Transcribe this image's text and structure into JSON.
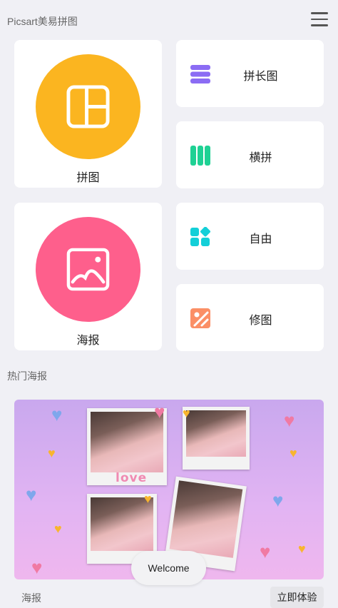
{
  "header": {
    "title": "Picsart美易拼图",
    "menu_icon": "menu-icon"
  },
  "tiles": {
    "collage": {
      "label": "拼图",
      "color": "#fbb520",
      "icon": "collage-grid-icon"
    },
    "poster": {
      "label": "海报",
      "color": "#fe5f8c",
      "icon": "image-icon"
    },
    "long": {
      "label": "拼长图",
      "color": "#8b6cf4",
      "icon": "stack-icon"
    },
    "horizontal": {
      "label": "横拼",
      "color": "#1fd194",
      "icon": "columns-icon"
    },
    "free": {
      "label": "自由",
      "color": "#13cfd8",
      "icon": "shapes-icon"
    },
    "edit": {
      "label": "修图",
      "color": "#fb8f66",
      "icon": "photo-edit-icon"
    }
  },
  "section": {
    "title": "热门海报"
  },
  "banner": {
    "love_text": "love"
  },
  "toast": {
    "text": "Welcome"
  },
  "footer": {
    "label": "海报",
    "button": "立即体验"
  }
}
